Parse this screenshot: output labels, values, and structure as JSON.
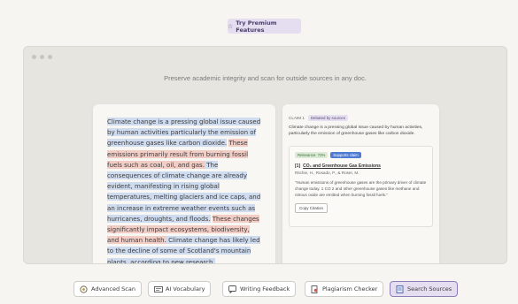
{
  "premium": {
    "label": "Try Premium Features",
    "icon": "star-icon"
  },
  "window": {
    "tagline": "Preserve academic integrity and scan for outside sources in any doc."
  },
  "document": {
    "segments": [
      {
        "text": "Climate change is a pressing global issue caused by human activities particularly the emission of greenhouse gases like carbon dioxide.",
        "highlight": "blue"
      },
      {
        "text": " ",
        "highlight": "none"
      },
      {
        "text": "These emissions primarily result from burning fossil fuels such as coal, oil, and gas.",
        "highlight": "red"
      },
      {
        "text": " The consequences of climate change are already evident, manifesting in rising global temperatures, melting glaciers and ice caps, and an increase in extreme weather events such as hurricanes, droughts, and floods.",
        "highlight": "blue"
      },
      {
        "text": " ",
        "highlight": "none"
      },
      {
        "text": "These changes significantly impact ecosystems, biodiversity, and human health.",
        "highlight": "red"
      },
      {
        "text": " Climate change has likely led to the decline of some of Scotland's mountain plants, according to new research.",
        "highlight": "blue"
      }
    ]
  },
  "claim": {
    "label": "CLAIM 1",
    "status": "Debated by sources",
    "text": "Climate change is a pressing global issue caused by human activities, particularly the emission of greenhouse gases like carbon dioxide.",
    "source": {
      "relevance": "Relevance: 72%",
      "support": "Supports claim",
      "number": "[1]",
      "title": "CO₂ and Greenhouse Gas Emissions",
      "authors": "Ritchie, H., Rosado, P., & Roser, M.",
      "quote": "\"Human emissions of greenhouse gases are the primary driver of climate change today. 1 CO 2 and other greenhouse gases like methane and nitrous oxide are emitted when burning fossil fuels.\"",
      "copy_label": "Copy Citation"
    }
  },
  "toolbar": {
    "items": [
      {
        "label": "Advanced Scan",
        "icon": "scan-icon",
        "active": false
      },
      {
        "label": "AI Vocabulary",
        "icon": "vocabulary-icon",
        "active": false
      },
      {
        "label": "Writing Feedback",
        "icon": "feedback-icon",
        "active": false
      },
      {
        "label": "Plagiarism Checker",
        "icon": "plagiarism-icon",
        "active": false
      },
      {
        "label": "Search Sources",
        "icon": "search-sources-icon",
        "active": true
      }
    ]
  },
  "colors": {
    "highlight_blue": "#cfdcf0",
    "highlight_red": "#f2cdc6",
    "accent_purple": "#e4def0",
    "supports_blue": "#4f7ad1"
  }
}
